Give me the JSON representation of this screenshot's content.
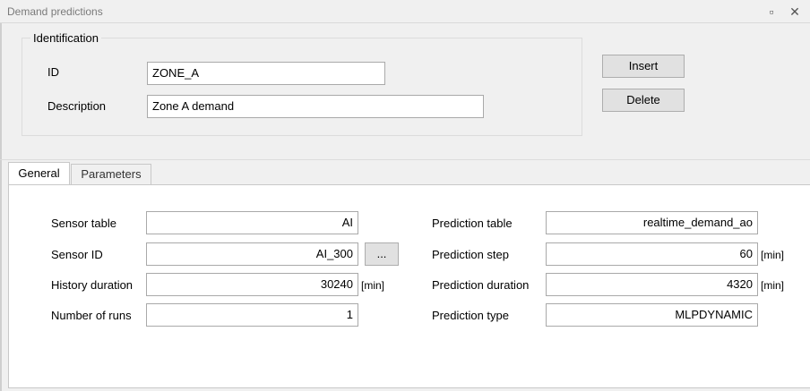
{
  "window": {
    "title": "Demand predictions",
    "restore_glyph": "▫",
    "close_glyph": "✕"
  },
  "identification": {
    "group_label": "Identification",
    "id_label": "ID",
    "id_value": "ZONE_A",
    "description_label": "Description",
    "description_value": "Zone A demand"
  },
  "actions": {
    "insert_label": "Insert",
    "delete_label": "Delete"
  },
  "tabs": [
    {
      "label": "General",
      "active": true
    },
    {
      "label": "Parameters",
      "active": false
    }
  ],
  "general": {
    "sensor_table_label": "Sensor table",
    "sensor_table_value": "AI",
    "sensor_id_label": "Sensor ID",
    "sensor_id_value": "AI_300",
    "browse_label": "...",
    "history_duration_label": "History duration",
    "history_duration_value": "30240",
    "history_duration_unit": "[min]",
    "number_of_runs_label": "Number of runs",
    "number_of_runs_value": "1",
    "prediction_table_label": "Prediction table",
    "prediction_table_value": "realtime_demand_ao",
    "prediction_step_label": "Prediction step",
    "prediction_step_value": "60",
    "prediction_step_unit": "[min]",
    "prediction_duration_label": "Prediction duration",
    "prediction_duration_value": "4320",
    "prediction_duration_unit": "[min]",
    "prediction_type_label": "Prediction type",
    "prediction_type_value": "MLPDYNAMIC"
  }
}
